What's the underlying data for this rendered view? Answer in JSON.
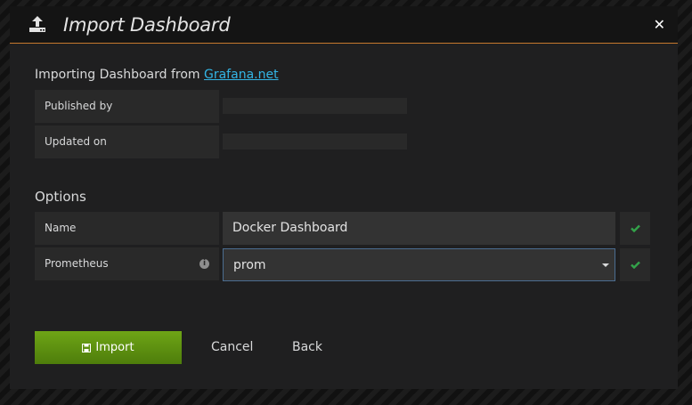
{
  "dialog": {
    "title": "Import Dashboard",
    "close_symbol": "✕"
  },
  "source": {
    "prefix": "Importing Dashboard from ",
    "link_text": "Grafana.net"
  },
  "info_rows": [
    {
      "label": "Published by",
      "value": ""
    },
    {
      "label": "Updated on",
      "value": ""
    }
  ],
  "options": {
    "title": "Options",
    "name_label": "Name",
    "name_value": "Docker Dashboard",
    "datasource_label": "Prometheus",
    "datasource_value": "prom"
  },
  "actions": {
    "import_label": "Import",
    "cancel_label": "Cancel",
    "back_label": "Back"
  },
  "colors": {
    "accent_orange": "#c6792d",
    "success_green": "#33a34a",
    "link_blue": "#33b5e5",
    "import_button": "#5d9512"
  }
}
